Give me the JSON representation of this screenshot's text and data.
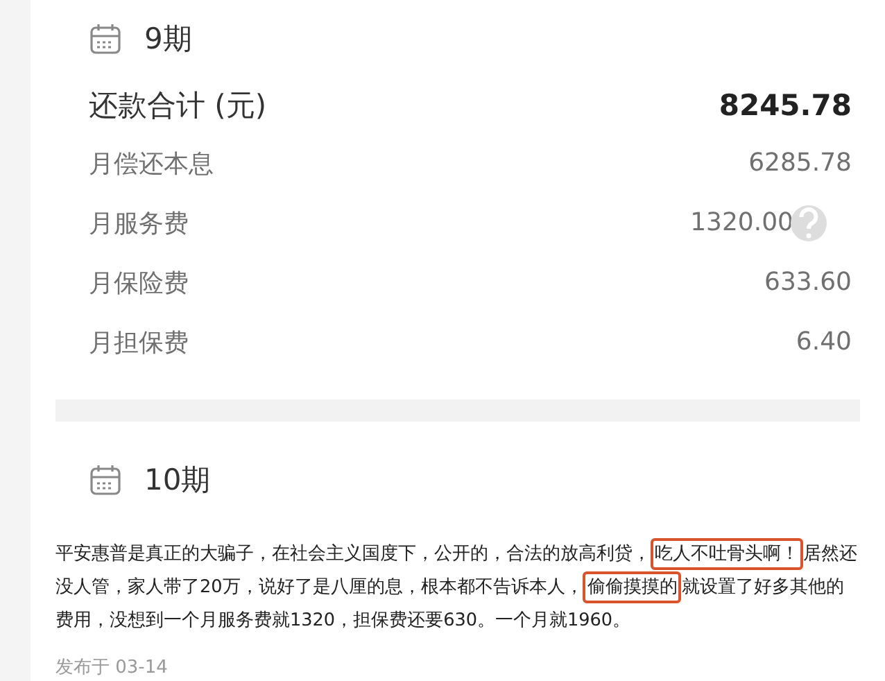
{
  "periods": [
    {
      "title": "9期",
      "total": {
        "label": "还款合计 (元)",
        "value": "8245.78"
      },
      "rows": [
        {
          "label": "月偿还本息",
          "value": "6285.78",
          "help": false
        },
        {
          "label": "月服务费",
          "value": "1320.00",
          "help": true
        },
        {
          "label": "月保险费",
          "value": "633.60",
          "help": false
        },
        {
          "label": "月担保费",
          "value": "6.40",
          "help": false
        }
      ]
    },
    {
      "title": "10期"
    }
  ],
  "post": {
    "segments": [
      {
        "text": "平安惠普是真正的大骗子，在社会主义国度下，公开的，合法的放高利贷，",
        "circled": false
      },
      {
        "text": "吃人不吐骨头啊！",
        "circled": true
      },
      {
        "text": "居然还没人管，家人带了20万，说好了是八厘的息，根本都不告诉本人，",
        "circled": false
      },
      {
        "text": "偷偷摸摸的",
        "circled": true
      },
      {
        "text": "就设置了好多其他的费用，没想到一个月服务费就1320，担保费还要630。一个月就1960。",
        "circled": false
      }
    ],
    "date": "发布于 03-14"
  }
}
